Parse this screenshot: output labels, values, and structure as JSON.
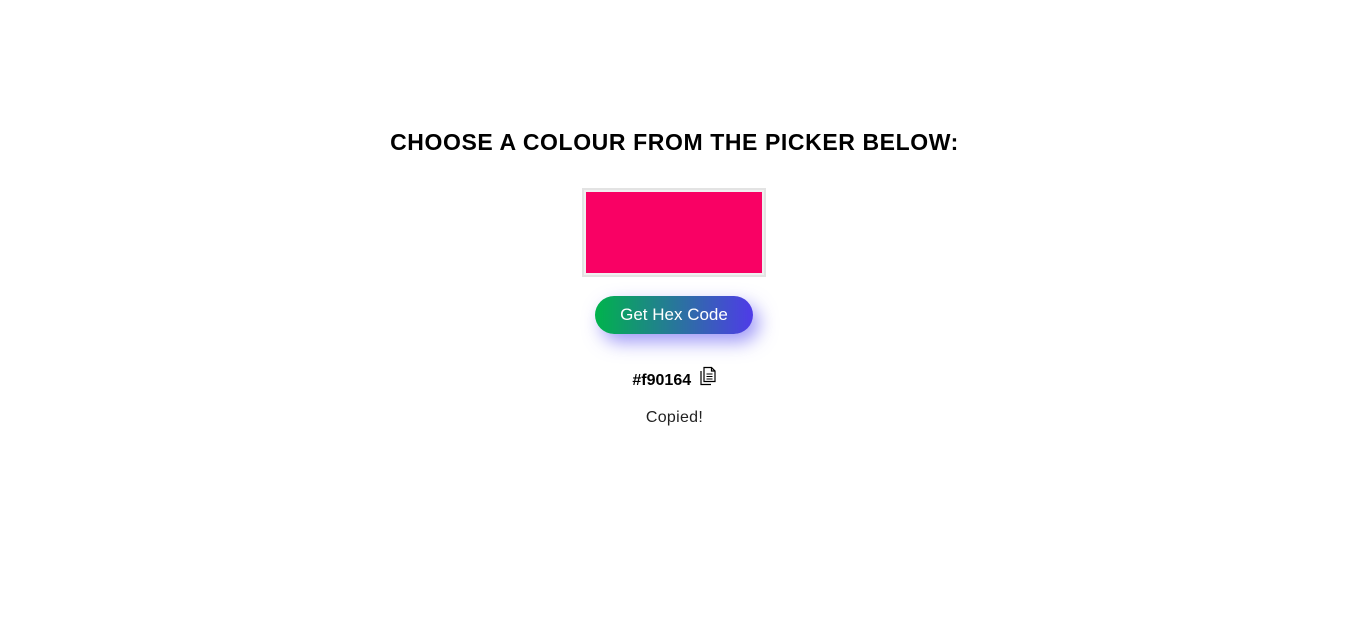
{
  "heading": "CHOOSE A COLOUR FROM THE PICKER BELOW:",
  "picker": {
    "value": "#f90164"
  },
  "button": {
    "label": "Get Hex Code",
    "gradient_start": "#00b34c",
    "gradient_end": "#4f3be8"
  },
  "result": {
    "hex_text": "#f90164",
    "copy_icon": "copy-icon",
    "status": "Copied!"
  }
}
